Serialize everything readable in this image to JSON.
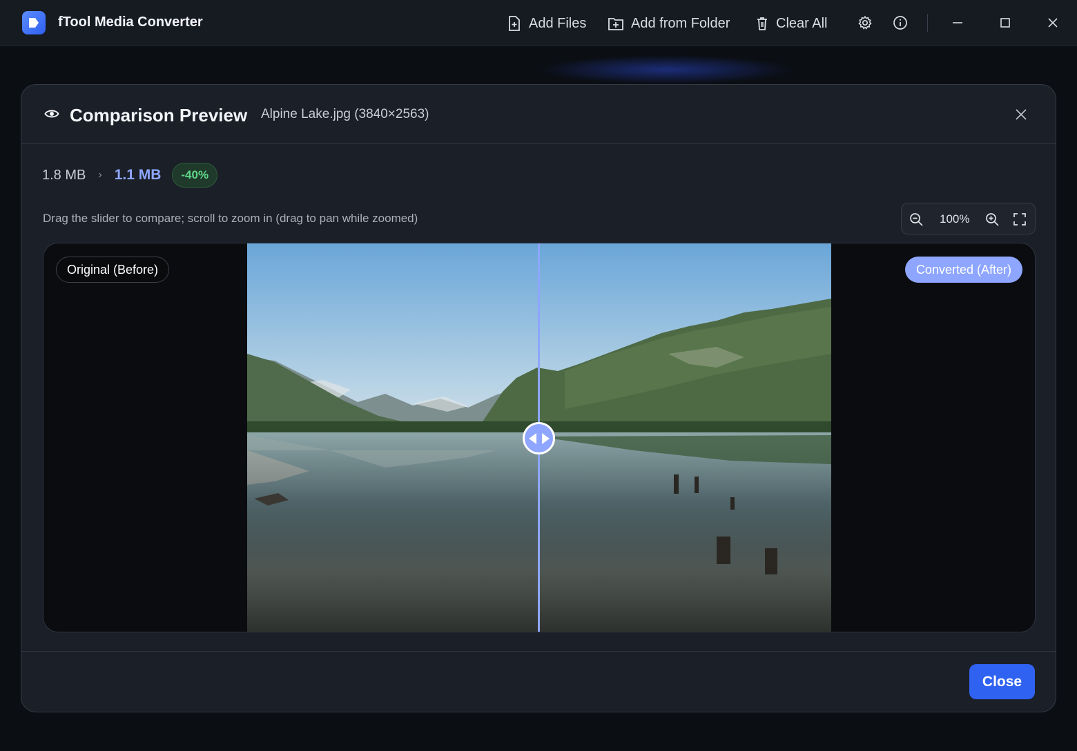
{
  "app": {
    "title": "fTool Media Converter",
    "logo_icon": "play-logo-icon"
  },
  "toolbar": {
    "add_files": "Add Files",
    "add_from_folder": "Add from Folder",
    "clear_all": "Clear All"
  },
  "dialog": {
    "title": "Comparison Preview",
    "file_info": "Alpine Lake.jpg (3840×2563)",
    "original_size": "1.8 MB",
    "converted_size": "1.1 MB",
    "reduction_badge": "-40%",
    "hint": "Drag the slider to compare; scroll to zoom in (drag to pan while zoomed)",
    "zoom_level": "100%",
    "label_before": "Original (Before)",
    "label_after": "Converted (After)",
    "slider_position": 0.5,
    "close_label": "Close"
  },
  "colors": {
    "accent": "#8ea6ff",
    "primary_button": "#2f62f0",
    "badge_green": "#5fd68a"
  }
}
